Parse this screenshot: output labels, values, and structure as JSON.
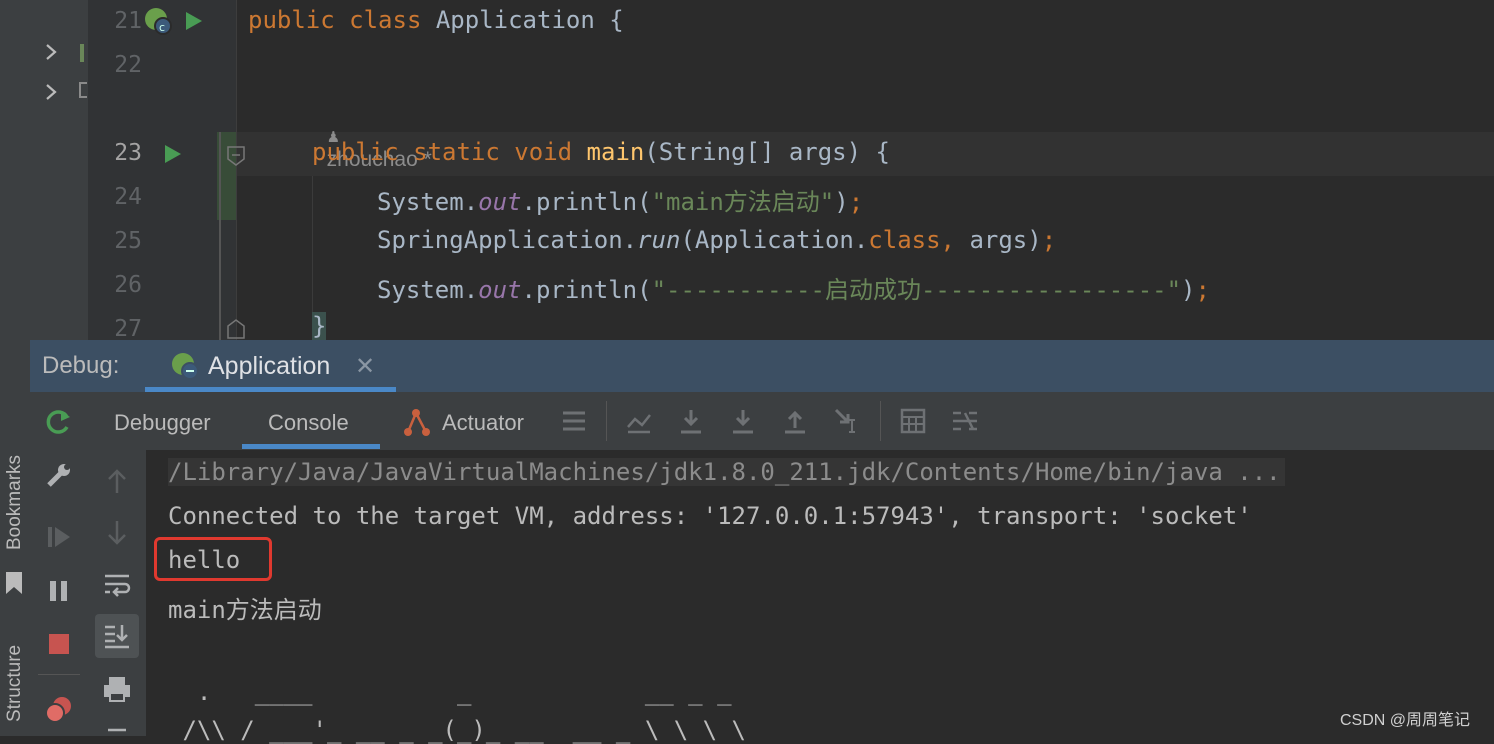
{
  "sidebar": {
    "bookmarks_label": "Bookmarks",
    "structure_label": "Structure"
  },
  "editor": {
    "author_hint": "zhouchao *",
    "lines": [
      {
        "no": "21",
        "tokens": [
          [
            "kw",
            "public class "
          ],
          [
            "plain",
            "Application {"
          ]
        ]
      },
      {
        "no": "22",
        "tokens": []
      },
      {
        "no": "23",
        "tokens": [
          [
            "kw",
            "public static void "
          ],
          [
            "fn",
            "main"
          ],
          [
            "plain",
            "(String[] args) "
          ],
          [
            "plain",
            "{"
          ]
        ]
      },
      {
        "no": "24",
        "tokens": [
          [
            "plain",
            "System."
          ],
          [
            "fld",
            "out"
          ],
          [
            "plain",
            ".println("
          ],
          [
            "str",
            "\"main方法启动\""
          ],
          [
            "plain",
            ")"
          ],
          [
            "kw",
            ";"
          ]
        ]
      },
      {
        "no": "25",
        "tokens": [
          [
            "plain",
            "SpringApplication."
          ],
          [
            "it",
            "run"
          ],
          [
            "plain",
            "(Application."
          ],
          [
            "kw",
            "class"
          ],
          [
            "kw",
            ","
          ],
          [
            "plain",
            " args)"
          ],
          [
            "kw",
            ";"
          ]
        ]
      },
      {
        "no": "26",
        "tokens": [
          [
            "plain",
            "System."
          ],
          [
            "fld",
            "out"
          ],
          [
            "plain",
            ".println("
          ],
          [
            "str",
            "\"-----------启动成功-----------------\""
          ],
          [
            "plain",
            ")"
          ],
          [
            "kw",
            ";"
          ]
        ]
      },
      {
        "no": "27",
        "tokens": [
          [
            "plain",
            "}"
          ]
        ]
      }
    ]
  },
  "debug": {
    "label": "Debug:",
    "run_config": "Application",
    "tabs": {
      "debugger": "Debugger",
      "console": "Console",
      "actuator": "Actuator"
    }
  },
  "console": {
    "lines": [
      "/Library/Java/JavaVirtualMachines/jdk1.8.0_211.jdk/Contents/Home/bin/java ...",
      "Connected to the target VM, address: '127.0.0.1:57943', transport: 'socket'",
      "hello",
      "main方法启动",
      "",
      "  .   ____          _            __ _ _",
      " /\\\\ / ___'_ __ _ _(_)_ __  __ _ \\ \\ \\ \\"
    ]
  },
  "watermark": "CSDN @周周笔记",
  "colors": {
    "keyword": "#cc7832",
    "function": "#ffc66d",
    "string": "#6a8759",
    "field": "#9876aa",
    "highlight_box": "#e0392f"
  }
}
